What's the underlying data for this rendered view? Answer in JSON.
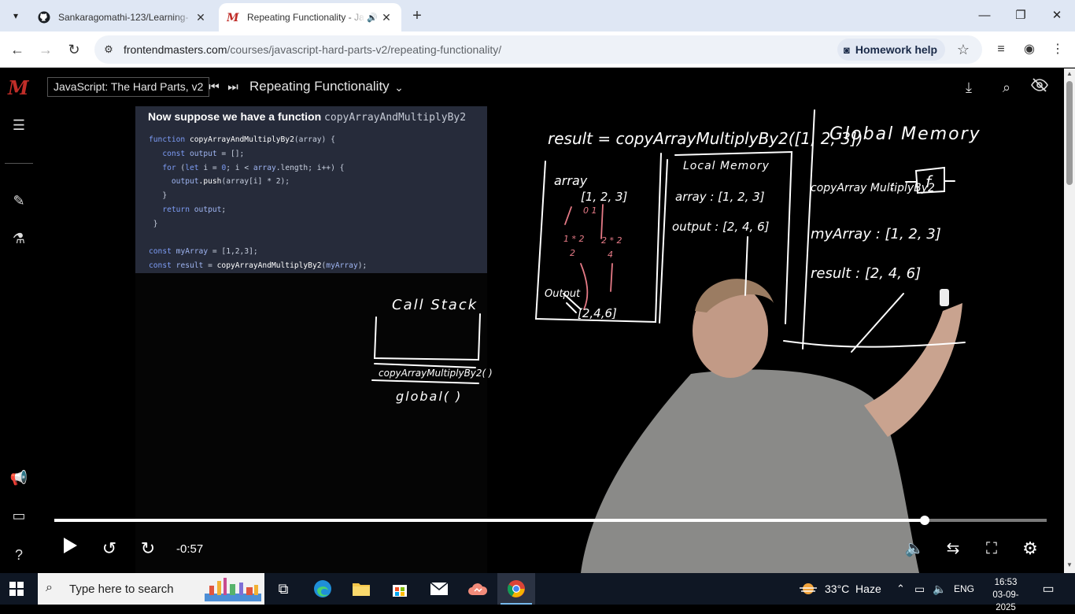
{
  "browser": {
    "tabs": [
      {
        "title": "Sankaragomathi-123/Learning-",
        "favicon": "github-icon",
        "active": false
      },
      {
        "title": "Repeating Functionality - Ja",
        "favicon": "frontendmasters-icon",
        "active": true,
        "audio": "speaker-icon"
      }
    ],
    "url": {
      "host": "frontendmasters.com",
      "path": "/courses/javascript-hard-parts-v2/repeating-functionality/"
    },
    "homework_help": "Homework help"
  },
  "player": {
    "course": "JavaScript: The Hard Parts, v2",
    "lesson": "Repeating Functionality",
    "time_remaining": "-0:57",
    "progress": 0.877
  },
  "slide": {
    "title_prefix": "Now suppose we have a function",
    "title_fn": "copyArrayAndMultiplyBy2",
    "code": {
      "l1_kw": "function",
      "l1_fn": "copyArrayAndMultiplyBy2",
      "l1_rest": "(array) {",
      "l2_kw": "const",
      "l2_var": "output",
      "l2_rest": " = [];",
      "l3_kw": "for",
      "l3_rest_a": " (",
      "l3_kw2": "let",
      "l3_rest_b": " i = ",
      "l3_num": "0",
      "l3_rest_c": "; i < ",
      "l3_var": "array",
      "l3_rest_d": ".length; i++) {",
      "l4_var": "output",
      "l4_fn": ".push",
      "l4_rest": "(array[i] * 2);",
      "l5": "}",
      "l6_kw": "return",
      "l6_var": "output",
      "l6_rest": ";",
      "l7": "}",
      "l8_kw": "const",
      "l8_var": "myArray",
      "l8_rest": " = [1,2,3];",
      "l9_kw": "const",
      "l9_var": "result",
      "l9_rest": " = ",
      "l9_fn": "copyArrayAndMultiplyBy2",
      "l9_rest2": "(",
      "l9_arg": "myArray",
      "l9_rest3": ");"
    }
  },
  "whiteboard": {
    "call_stack": "Call Stack",
    "stack_frames": [
      "copyArrayMultiplyBy2( )",
      "global( )"
    ],
    "result_line": "result = copyArrayMultiplyBy2([1, 2, 3])",
    "local_memory": "Local Memory",
    "local_array": "array : [1, 2, 3]",
    "local_output": "output : [2, 4, 6]",
    "array_label": "array",
    "array_vals": "[1, 2, 3]",
    "index_labels": "0   1",
    "calc1": "1 * 2",
    "calc1b": "2",
    "calc2": "2 * 2",
    "calc2b": "4",
    "output_label": "Output",
    "output_vals": "[2,4,6]",
    "global_memory": "Global Memory",
    "g_fn": "copyArray MultiplyBy2",
    "g_fn_val": "f",
    "g_myarray": "myArray : [1, 2, 3]",
    "g_result": "result : [2, 4, 6]"
  },
  "taskbar": {
    "search_placeholder": "Type here to search",
    "weather": "33°C  Haze",
    "lang": "ENG",
    "time": "16:53",
    "date": "03-09-2025"
  },
  "colors": {
    "accent_red": "#c02d28",
    "slide_bg": "#262b3a",
    "chalk": "#ffffff",
    "chalk_pink": "#e57a86"
  }
}
